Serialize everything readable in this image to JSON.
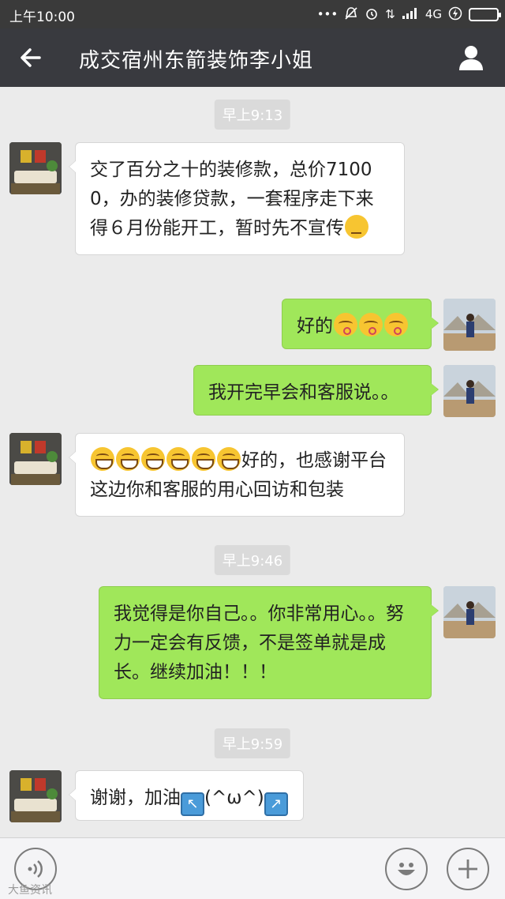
{
  "status_bar": {
    "time": "上午10:00",
    "network": "4G",
    "icons": [
      "dots-icon",
      "mute-icon",
      "alarm-icon",
      "data-arrows-icon",
      "signal-icon",
      "charging-icon",
      "battery-icon"
    ]
  },
  "header": {
    "title": "成交宿州东箭装饰李小姐",
    "back_icon": "back-arrow-icon",
    "profile_icon": "person-icon"
  },
  "timestamps": [
    "早上9:13",
    "早上9:46",
    "早上9:59"
  ],
  "messages": [
    {
      "side": "left",
      "text": "交了百分之十的装修款，总价71000，办的装修贷款，一套程序走下来得６月份能开工，暂时先不宣传",
      "emojis": [
        "thinking-emoji"
      ]
    },
    {
      "side": "right",
      "text": "好的",
      "emojis": [
        "kiss-emoji",
        "kiss-emoji",
        "kiss-emoji"
      ]
    },
    {
      "side": "right",
      "text": "我开完早会和客服说。。"
    },
    {
      "side": "left",
      "text": "好的，也感谢平台这边你和客服的用心回访和包装",
      "emojis_before": [
        "grin-emoji",
        "grin-emoji",
        "grin-emoji",
        "grin-emoji",
        "grin-emoji",
        "grin-emoji"
      ]
    },
    {
      "side": "right",
      "text": "我觉得是你自己。。你非常用心。。努力一定会有反馈，不是签单就是成长。继续加油！！！"
    },
    {
      "side": "left",
      "text_a": "谢谢，加油",
      "text_b": "(^ω^)",
      "icons": [
        "arrow-upleft-icon",
        "arrow-upright-icon"
      ]
    }
  ],
  "input_bar": {
    "voice_icon": "voice-icon",
    "emoji_icon": "smiley-icon",
    "plus_icon": "plus-icon"
  },
  "watermark": "大鱼资讯",
  "colors": {
    "header_bg": "#393a3f",
    "chat_bg": "#ebebeb",
    "sent_bubble": "#a0e75a",
    "received_bubble": "#ffffff"
  }
}
